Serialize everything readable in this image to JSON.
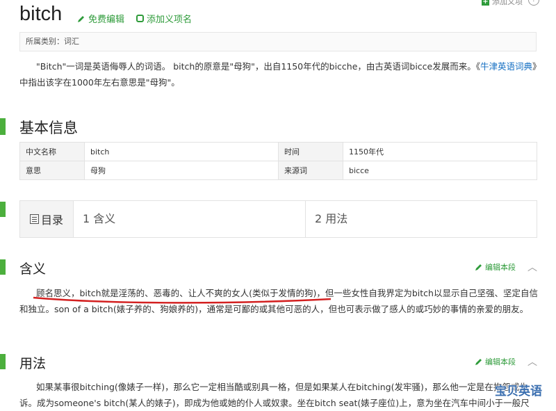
{
  "header": {
    "title": "bitch",
    "edit_label": "免费编辑",
    "add_meaning_label": "添加义项名",
    "top_right_label": "添加义项",
    "help_glyph": "?"
  },
  "category": "所属类别：词汇",
  "intro": {
    "text_before": "\"Bitch\"一词是英语侮辱人的词语。 bitch的原意是\"母狗\"，出自1150年代的bicche，由古英语词bicce发展而来。《",
    "link": "牛津英语词典",
    "text_after": "》中指出该字在1000年左右意思是\"母狗\"。"
  },
  "basic_info": {
    "heading": "基本信息",
    "rows": [
      {
        "k1": "中文名称",
        "v1": "bitch",
        "k2": "时间",
        "v2": "1150年代"
      },
      {
        "k1": "意思",
        "v1": "母狗",
        "k2": "来源词",
        "v2": "bicce"
      }
    ]
  },
  "toc": {
    "label": "目录",
    "items": [
      "1 含义",
      "2 用法"
    ]
  },
  "section_meaning": {
    "heading": "含义",
    "edit_label": "编辑本段",
    "underlined": "顾名思义，bitch就是淫荡的、恶毒的、让人不爽的女人(类似于发情的狗)",
    "rest": "，但一些女性自我界定为bitch以显示自己坚强、坚定自信和独立。son of a bitch(婊子养的、狗娘养的)，通常是可鄙的或其他可恶的人，但也可表示做了感人的或巧妙的事情的亲爱的朋友。"
  },
  "section_usage": {
    "heading": "用法",
    "edit_label": "编辑本段",
    "text": "如果某事很bitching(像婊子一样)，那么它一定相当酷或别具一格，但是如果某人在bitching(发牢骚)，那么他一定是在抱怨或生诉。成为someone's bitch(某人的婊子)，即成为他或她的仆人或奴隶。坐在bitch seat(婊子座位)上，意为坐在汽车中间小于一般尺"
  },
  "watermark": "宝贝英语",
  "colors": {
    "accent": "#2e9b3a",
    "bar": "#4caf3d",
    "link": "#136ec2",
    "underline": "#d32020"
  }
}
